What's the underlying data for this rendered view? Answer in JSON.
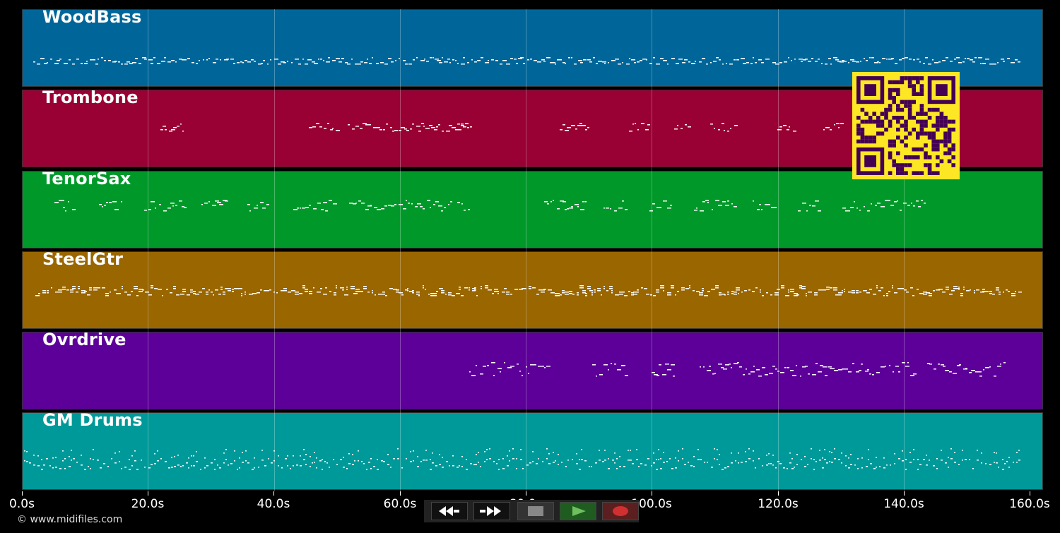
{
  "tracks": [
    {
      "name": "WoodBass",
      "color": "#006699"
    },
    {
      "name": "Trombone",
      "color": "#990033"
    },
    {
      "name": "TenorSax",
      "color": "#009929"
    },
    {
      "name": "SteelGtr",
      "color": "#996600"
    },
    {
      "name": "Ovrdrive",
      "color": "#5c0099"
    },
    {
      "name": "GM Drums",
      "color": "#009999"
    }
  ],
  "timeline": {
    "max_seconds": 160,
    "ticks": [
      "0.0s",
      "20.0s",
      "40.0s",
      "60.0s",
      "80.0s",
      "100.0s",
      "120.0s",
      "140.0s",
      "160.0s"
    ]
  },
  "copyright": "© www.midifiles.com",
  "qr_colors": {
    "background": "#fde725",
    "module": "#440154"
  },
  "transport": [
    {
      "name": "rewind-button",
      "icon": "rewind-icon",
      "color": "#111111"
    },
    {
      "name": "fast-forward-button",
      "icon": "fast-forward-icon",
      "color": "#111111"
    },
    {
      "name": "stop-button",
      "icon": "stop-icon",
      "color": "#333333"
    },
    {
      "name": "play-button",
      "icon": "play-icon",
      "color": "#1f5c1f"
    },
    {
      "name": "record-button",
      "icon": "record-icon",
      "color": "#5c1f1f"
    }
  ]
}
